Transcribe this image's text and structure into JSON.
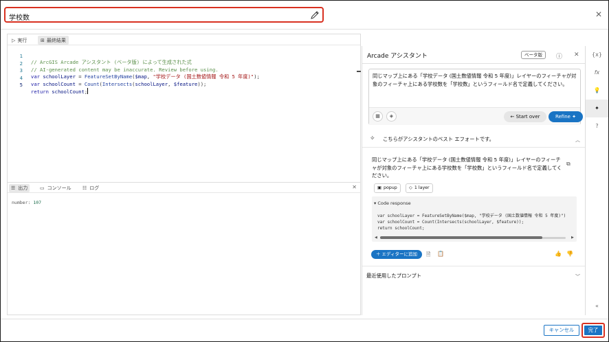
{
  "header": {
    "title": "学校数"
  },
  "editor": {
    "tabs": [
      {
        "label": "実行"
      },
      {
        "label": "最終結果"
      }
    ],
    "lines": [
      {
        "n": "1",
        "comment": "// ArcGIS Arcade アシスタント (ベータ版) によって生成された式"
      },
      {
        "n": "2",
        "comment": "// AI-generated content may be inaccurate. Review before using."
      },
      {
        "n": "3",
        "kw": "var",
        "name": "schoolLayer",
        "eq": " = ",
        "fn": "FeatureSetByName",
        "open": "(",
        "arg": "$map",
        "sep": ", ",
        "str": "\"学校データ (国土数値情報 令和 5 年度)\"",
        "close": ");"
      },
      {
        "n": "4",
        "kw": "var",
        "name": "schoolCount",
        "eq": " = ",
        "fn": "Count",
        "open": "(",
        "fn2": "Intersects",
        "open2": "(",
        "arg": "schoolLayer",
        "sep": ", ",
        "arg2": "$feature",
        "close": "));"
      },
      {
        "n": "5",
        "kw": "return",
        "name": "schoolCount",
        "close": ";"
      }
    ]
  },
  "output": {
    "tabs": [
      {
        "label": "出力"
      },
      {
        "label": "コンソール"
      },
      {
        "label": "ログ"
      }
    ],
    "label": "number:",
    "value": "107"
  },
  "assistant": {
    "title": "Arcade アシスタント",
    "beta": "ベータ版",
    "prompt": "同じマップ上にある「学校データ (国土数値情報 令和 5 年度)」レイヤーのフィーチャが対象のフィーチャ上にある学校数を「学校数」というフィールド名で定義してください。",
    "start_over": "Start over",
    "refine": "Refine",
    "best_effort": "こちらがアシスタントのベスト エフォートです。",
    "response": "同じマップ上にある「学校データ (国土数値情報 令和 5 年度)」レイヤーのフィーチャが対象のフィーチャ上にある学校数を「学校数」というフィールド名で定義してください。",
    "chips": [
      {
        "label": "popup"
      },
      {
        "label": "1 layer"
      }
    ],
    "code_response_label": "Code response",
    "code_response": "var schoolLayer = FeatureSetByName($map, \"学校データ (国土数値情報 令和 5 年度)\")\nvar schoolCount = Count(Intersects(schoolLayer, $feature));\nreturn schoolCount;",
    "add_to_editor": "エディターに追加",
    "recent_prompts": "最近使用したプロンプト"
  },
  "rail": [
    {
      "label": "{x}"
    },
    {
      "label": "fx"
    },
    {
      "label": "💡"
    },
    {
      "label": "✦"
    },
    {
      "label": "?"
    },
    {
      "label": "«"
    }
  ],
  "footer": {
    "cancel": "キャンセル",
    "done": "完了"
  },
  "colors": {
    "accent": "#1a74c4",
    "highlight": "#d83020"
  }
}
